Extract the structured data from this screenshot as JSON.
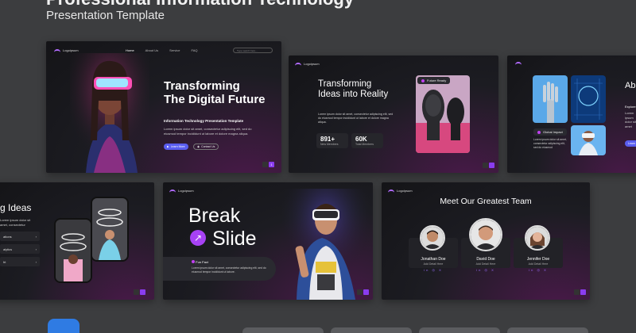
{
  "header": {
    "title": "Professional Information Technology",
    "subtitle": "Presentation Template"
  },
  "logo_text": "Logoipsum",
  "slide1": {
    "nav": [
      "Home",
      "About Us",
      "Service",
      "FAQ"
    ],
    "search_placeholder": "Type search here...",
    "heading_l1": "Transforming",
    "heading_l2": "The Digital Future",
    "subheading": "Information Technology Presentation Template",
    "body": "Lorem ipsum dolor sit amet, consectetur adipiscing elit, sed do eiusmod tempor incididunt ut labore et dolore magna aliqua.",
    "btn_primary": "Learn More",
    "btn_secondary": "Contact Us",
    "page": "1"
  },
  "slide2": {
    "heading_l1": "Transforming",
    "heading_l2": "Ideas into Reality",
    "body": "Lorem ipsum dolor sit amet, consectetur adipiscing elit, sed do eiusmod tempor incididunt ut labore et dolore magna aliqua.",
    "stat1_num": "891+",
    "stat1_label": "New Members",
    "stat2_num": "60K",
    "stat2_label": "Total Members",
    "badge": "Future Ready"
  },
  "slide3": {
    "heading": "Ab",
    "sub": "Explore",
    "badge": "Global Impact",
    "btn": "Learn"
  },
  "slide4": {
    "heading": "g Ideas",
    "items": [
      "ations",
      "alytics",
      "ht"
    ]
  },
  "slide5": {
    "l1": "Break",
    "l2": "Slide",
    "fact_title": "Fun Fact",
    "fact_body": "Lorem ipsum dolor sit amet, consectetur adipiscing elit, sed do eiusmod tempor incididunt ut labore.",
    "arrow_icon": "arrow-up-right-icon"
  },
  "slide6": {
    "title": "Meet Our Greatest Team",
    "members": [
      {
        "name": "Jonathan Doe",
        "role": "Add Detail Here"
      },
      {
        "name": "David Doe",
        "role": "Add Detail Here"
      },
      {
        "name": "Jennifer Doe",
        "role": "Add Detail Here"
      }
    ],
    "socials": "in ◎ X"
  },
  "colors": {
    "accent": "#8a3cf0",
    "button": "#5a5ef0",
    "background": "#3c3d3f"
  }
}
